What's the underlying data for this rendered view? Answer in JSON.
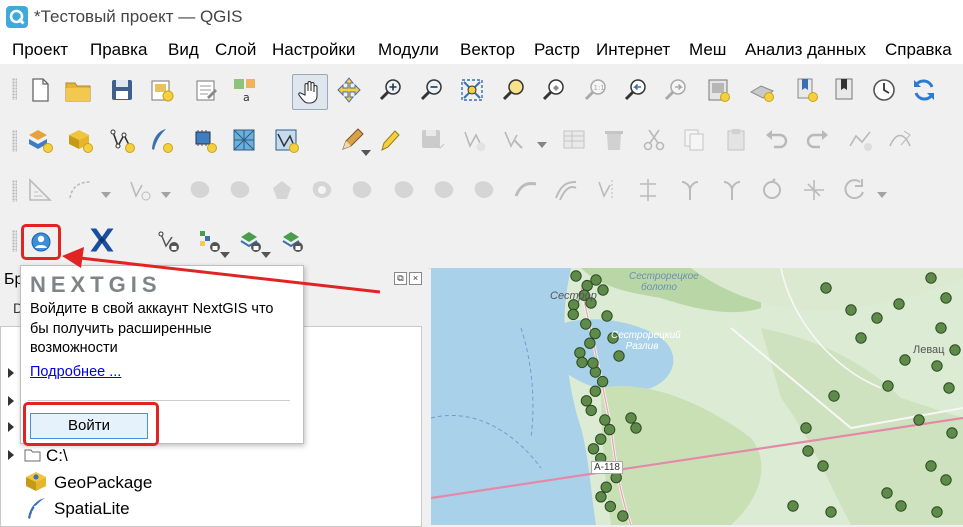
{
  "window": {
    "title": "*Тестовый проект — QGIS"
  },
  "menu": [
    "Проект",
    "Правка",
    "Вид",
    "Слой",
    "Настройки",
    "Модули",
    "Вектор",
    "Растр",
    "Интернет",
    "Меш",
    "Анализ данных",
    "Справка"
  ],
  "browser_panel": {
    "title": "Бр",
    "truncated_row_glyph": "D",
    "items": [
      {
        "label": "C:\\",
        "icon": "folder-icon",
        "expandable": true
      },
      {
        "label": "GeoPackage",
        "icon": "geopackage-icon",
        "expandable": false
      },
      {
        "label": "SpatiaLite",
        "icon": "spatialite-feather-icon",
        "expandable": false
      }
    ]
  },
  "nextgis_popup": {
    "logo_text": "NEXTGIS",
    "message": "Войдите в свой аккаунт NextGIS что бы получить расширенные возможности",
    "link": "Подробнее ...",
    "login_button": "Войти"
  },
  "map": {
    "labels": [
      "Сестрор",
      "Сестрорецкое болото",
      "Сестрорецкий Разлив",
      "Левац",
      "А-118"
    ]
  },
  "colors": {
    "highlight": "#e02424",
    "link": "#0000ee",
    "map_water": "#a9d1ea",
    "map_land": "#dcebd3",
    "map_forest": "#b9d7a6",
    "point_fill": "#5e8a4a"
  }
}
